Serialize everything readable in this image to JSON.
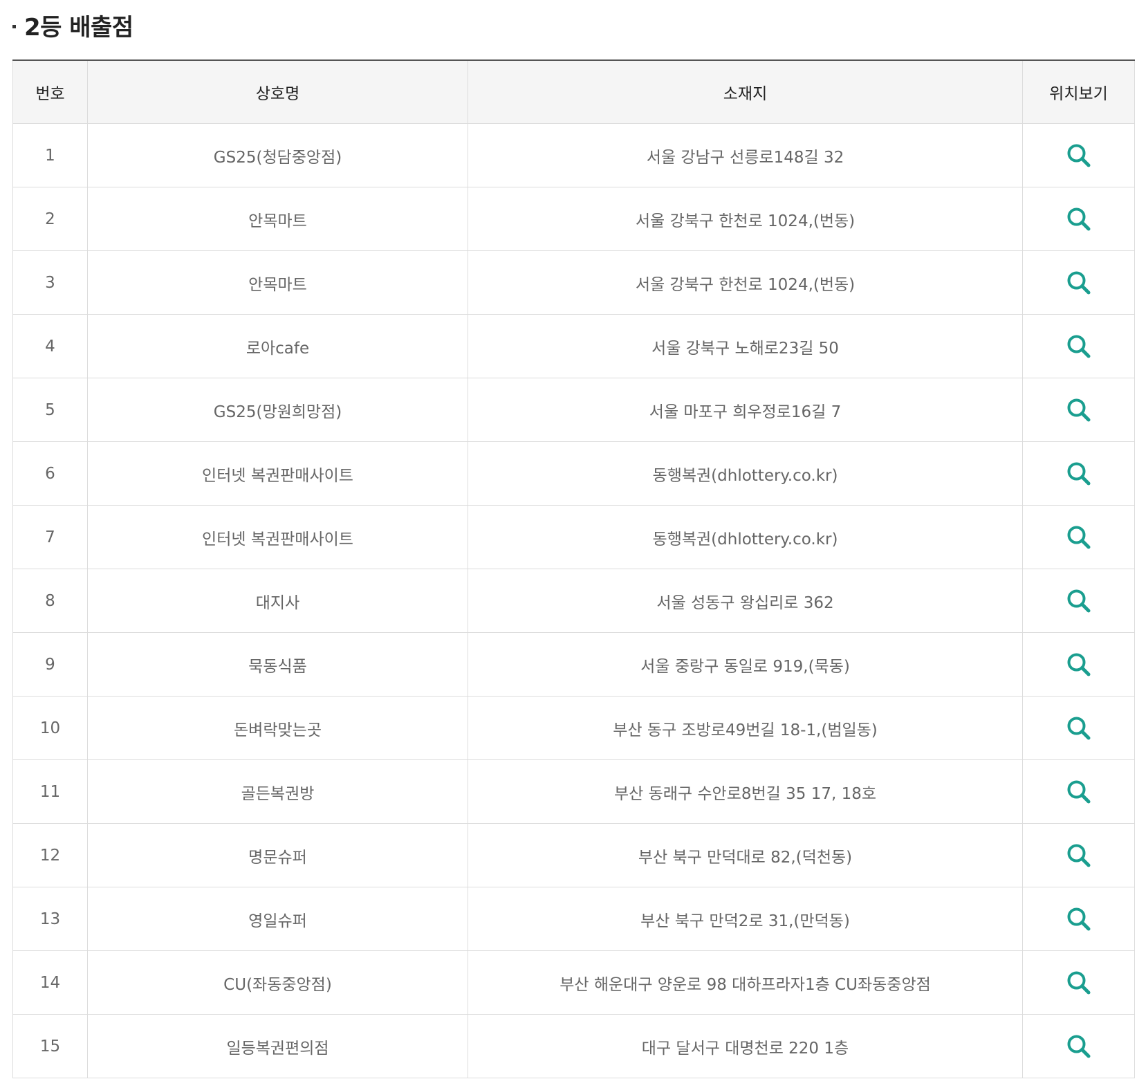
{
  "section": {
    "title": "2등 배출점"
  },
  "table": {
    "headers": {
      "no": "번호",
      "name": "상호명",
      "address": "소재지",
      "map": "위치보기"
    },
    "rows": [
      {
        "no": "1",
        "name": "GS25(청담중앙점)",
        "address": "서울 강남구 선릉로148길 32"
      },
      {
        "no": "2",
        "name": "안목마트",
        "address": "서울 강북구 한천로 1024,(번동)"
      },
      {
        "no": "3",
        "name": "안목마트",
        "address": "서울 강북구 한천로 1024,(번동)"
      },
      {
        "no": "4",
        "name": "로아cafe",
        "address": "서울 강북구 노해로23길 50"
      },
      {
        "no": "5",
        "name": "GS25(망원희망점)",
        "address": "서울 마포구 희우정로16길 7"
      },
      {
        "no": "6",
        "name": "인터넷 복권판매사이트",
        "address": "동행복권(dhlottery.co.kr)"
      },
      {
        "no": "7",
        "name": "인터넷 복권판매사이트",
        "address": "동행복권(dhlottery.co.kr)"
      },
      {
        "no": "8",
        "name": "대지사",
        "address": "서울 성동구 왕십리로 362"
      },
      {
        "no": "9",
        "name": "묵동식품",
        "address": "서울 중랑구 동일로 919,(묵동)"
      },
      {
        "no": "10",
        "name": "돈벼락맞는곳",
        "address": "부산 동구 조방로49번길 18-1,(범일동)"
      },
      {
        "no": "11",
        "name": "골든복권방",
        "address": "부산 동래구 수안로8번길 35 17, 18호"
      },
      {
        "no": "12",
        "name": "명문슈퍼",
        "address": "부산 북구 만덕대로 82,(덕천동)"
      },
      {
        "no": "13",
        "name": "영일슈퍼",
        "address": "부산 북구 만덕2로 31,(만덕동)"
      },
      {
        "no": "14",
        "name": "CU(좌동중앙점)",
        "address": "부산 해운대구 양운로 98 대하프라자1층 CU좌동중앙점"
      },
      {
        "no": "15",
        "name": "일등복권편의점",
        "address": "대구 달서구 대명천로 220 1층"
      }
    ]
  },
  "icons": {
    "map": "search-icon"
  },
  "colors": {
    "icon": "#1a9e8f",
    "header_bg": "#f5f5f5",
    "border": "#dcdcdc"
  }
}
